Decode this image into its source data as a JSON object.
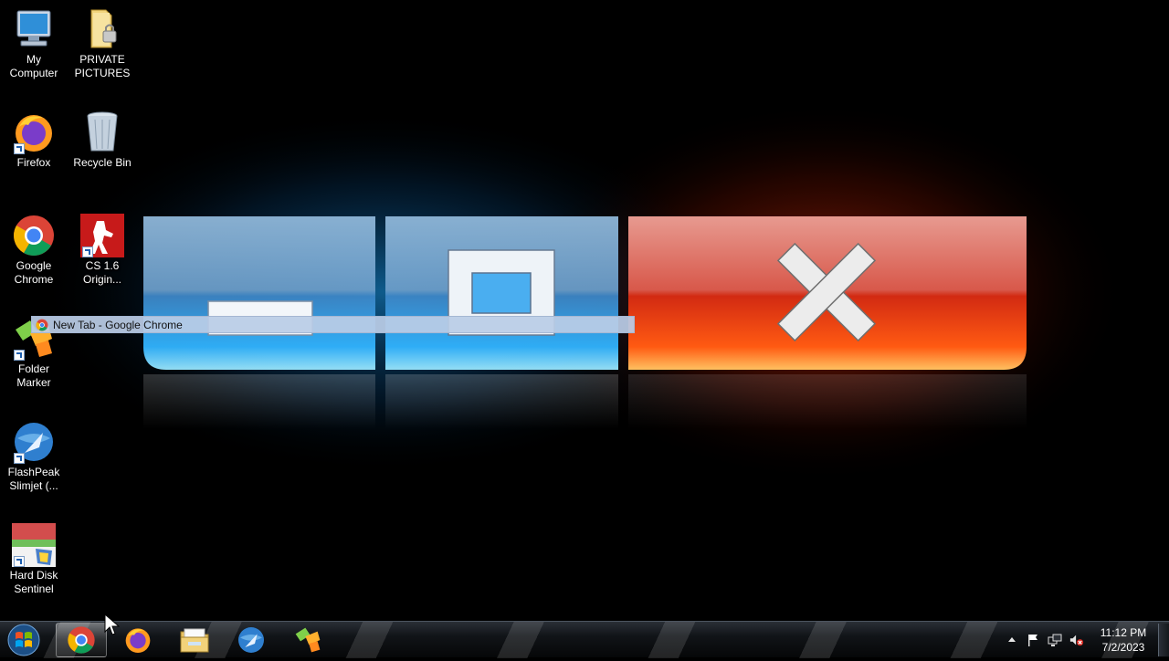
{
  "desktop": {
    "icons": [
      {
        "label": "My\nComputer",
        "icon": "computer-icon"
      },
      {
        "label": "PRIVATE\nPICTURES",
        "icon": "locked-folder-icon"
      },
      {
        "label": "Firefox",
        "icon": "firefox-icon"
      },
      {
        "label": "Recycle Bin",
        "icon": "recycle-bin-icon"
      },
      {
        "label": "Google\nChrome",
        "icon": "chrome-icon"
      },
      {
        "label": "CS 1.6\nOrigin...",
        "icon": "counter-strike-icon"
      },
      {
        "label": "Folder\nMarker",
        "icon": "folder-marker-icon"
      },
      {
        "label": "FlashPeak\nSlimjet (...",
        "icon": "slimjet-icon"
      },
      {
        "label": "Hard Disk\nSentinel",
        "icon": "hard-disk-sentinel-icon"
      }
    ]
  },
  "tooltip": {
    "text": "New Tab - Google Chrome",
    "icon": "chrome-icon"
  },
  "taskbar": {
    "start_icon": "windows-start-icon",
    "pinned": [
      {
        "name": "Google Chrome",
        "icon": "chrome-icon",
        "active": true
      },
      {
        "name": "Firefox",
        "icon": "firefox-icon",
        "active": false
      },
      {
        "name": "Windows Explorer",
        "icon": "explorer-folder-icon",
        "active": false
      },
      {
        "name": "FlashPeak Slimjet",
        "icon": "slimjet-icon",
        "active": false
      },
      {
        "name": "Folder Marker",
        "icon": "folder-marker-icon",
        "active": false
      }
    ],
    "tray": {
      "icons": [
        "show-hidden-icons-arrow",
        "action-center-flag-icon",
        "network-icon",
        "volume-muted-icon"
      ],
      "time": "11:12 PM",
      "date": "7/2/2023"
    }
  },
  "colors": {
    "accent_blue": "#3fb6ff",
    "accent_red": "#ff3a10",
    "taskbar": "#111418"
  }
}
